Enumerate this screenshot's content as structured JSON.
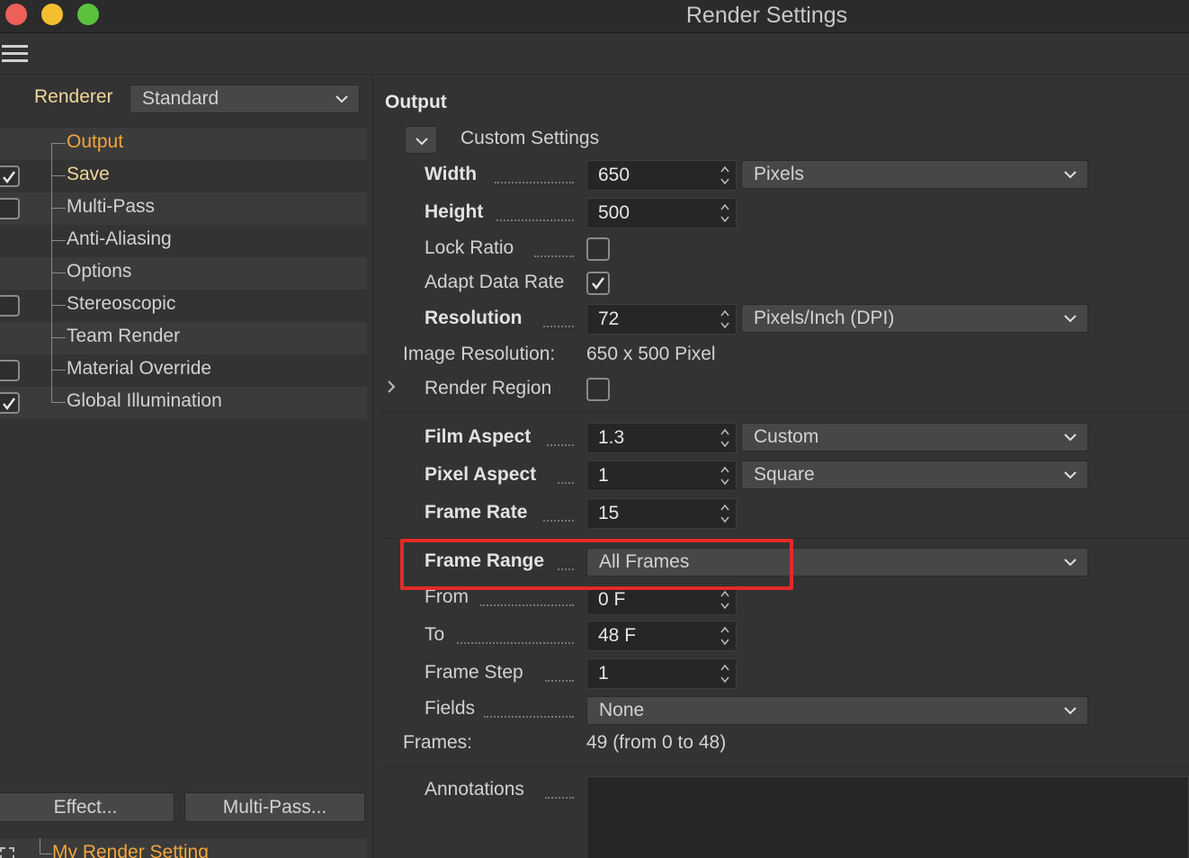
{
  "window": {
    "title": "Render Settings"
  },
  "left_panel": {
    "renderer_label": "Renderer",
    "renderer_value": "Standard",
    "tree": [
      {
        "label": "Output",
        "color": "#f1a53d",
        "checkbox": null
      },
      {
        "label": "Save",
        "color": "#f0d79a",
        "checkbox": true
      },
      {
        "label": "Multi-Pass",
        "checkbox": false
      },
      {
        "label": "Anti-Aliasing",
        "checkbox": null
      },
      {
        "label": "Options",
        "checkbox": null
      },
      {
        "label": "Stereoscopic",
        "checkbox": false
      },
      {
        "label": "Team Render",
        "checkbox": null
      },
      {
        "label": "Material Override",
        "checkbox": false
      },
      {
        "label": "Global Illumination",
        "checkbox": true
      }
    ],
    "effect_button": "Effect...",
    "multipass_button": "Multi-Pass...",
    "preset_name": "My Render Setting"
  },
  "output": {
    "title": "Output",
    "preset_label": "Custom Settings",
    "width_label": "Width",
    "width_value": "650",
    "width_unit": "Pixels",
    "height_label": "Height",
    "height_value": "500",
    "lock_ratio_label": "Lock Ratio",
    "lock_ratio_checked": false,
    "adapt_data_rate_label": "Adapt Data Rate",
    "adapt_data_rate_checked": true,
    "resolution_label": "Resolution",
    "resolution_value": "72",
    "resolution_unit": "Pixels/Inch (DPI)",
    "image_resolution_label": "Image Resolution:",
    "image_resolution_value": "650 x 500 Pixel",
    "render_region_label": "Render Region",
    "render_region_checked": false,
    "film_aspect_label": "Film Aspect",
    "film_aspect_value": "1.3",
    "film_aspect_preset": "Custom",
    "pixel_aspect_label": "Pixel Aspect",
    "pixel_aspect_value": "1",
    "pixel_aspect_preset": "Square",
    "frame_rate_label": "Frame Rate",
    "frame_rate_value": "15",
    "frame_range_label": "Frame Range",
    "frame_range_value": "All Frames",
    "from_label": "From",
    "from_value": "0 F",
    "to_label": "To",
    "to_value": "48 F",
    "frame_step_label": "Frame Step",
    "frame_step_value": "1",
    "fields_label": "Fields",
    "fields_value": "None",
    "frames_label": "Frames:",
    "frames_value": "49 (from 0 to 48)",
    "annotations_label": "Annotations"
  },
  "colors": {
    "highlight": "#e52a28",
    "accent_orange": "#f1a53d",
    "accent_yellow": "#f0d79a"
  }
}
